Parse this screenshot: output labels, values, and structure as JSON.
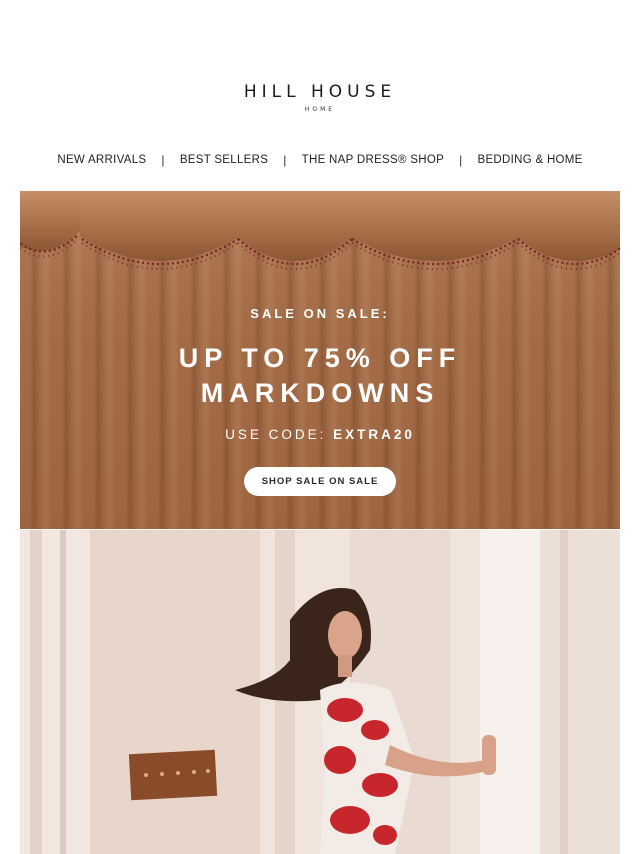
{
  "brand": {
    "name": "HILL HOUSE",
    "sub": "HOME"
  },
  "nav": {
    "items": [
      {
        "label": "NEW ARRIVALS"
      },
      {
        "label": "BEST SELLERS"
      },
      {
        "label": "THE NAP DRESS® SHOP"
      },
      {
        "label": "BEDDING & HOME"
      }
    ],
    "separator": "|"
  },
  "hero": {
    "eyebrow": "SALE ON SALE:",
    "headline_line1": "UP TO 75% OFF",
    "headline_line2": "MARKDOWNS",
    "code_label": "USE CODE:",
    "code_value": "EXTRA20",
    "cta_label": "SHOP SALE ON SALE",
    "colors": {
      "curtain": "#a36c47",
      "tassel": "#7a1f26",
      "text": "#ffffff"
    }
  },
  "photo": {
    "subject": "model-in-red-floral-dress",
    "colors": {
      "wall": "#e6d3c8",
      "door": "#f1e6df",
      "dress_red": "#c8262d"
    }
  }
}
